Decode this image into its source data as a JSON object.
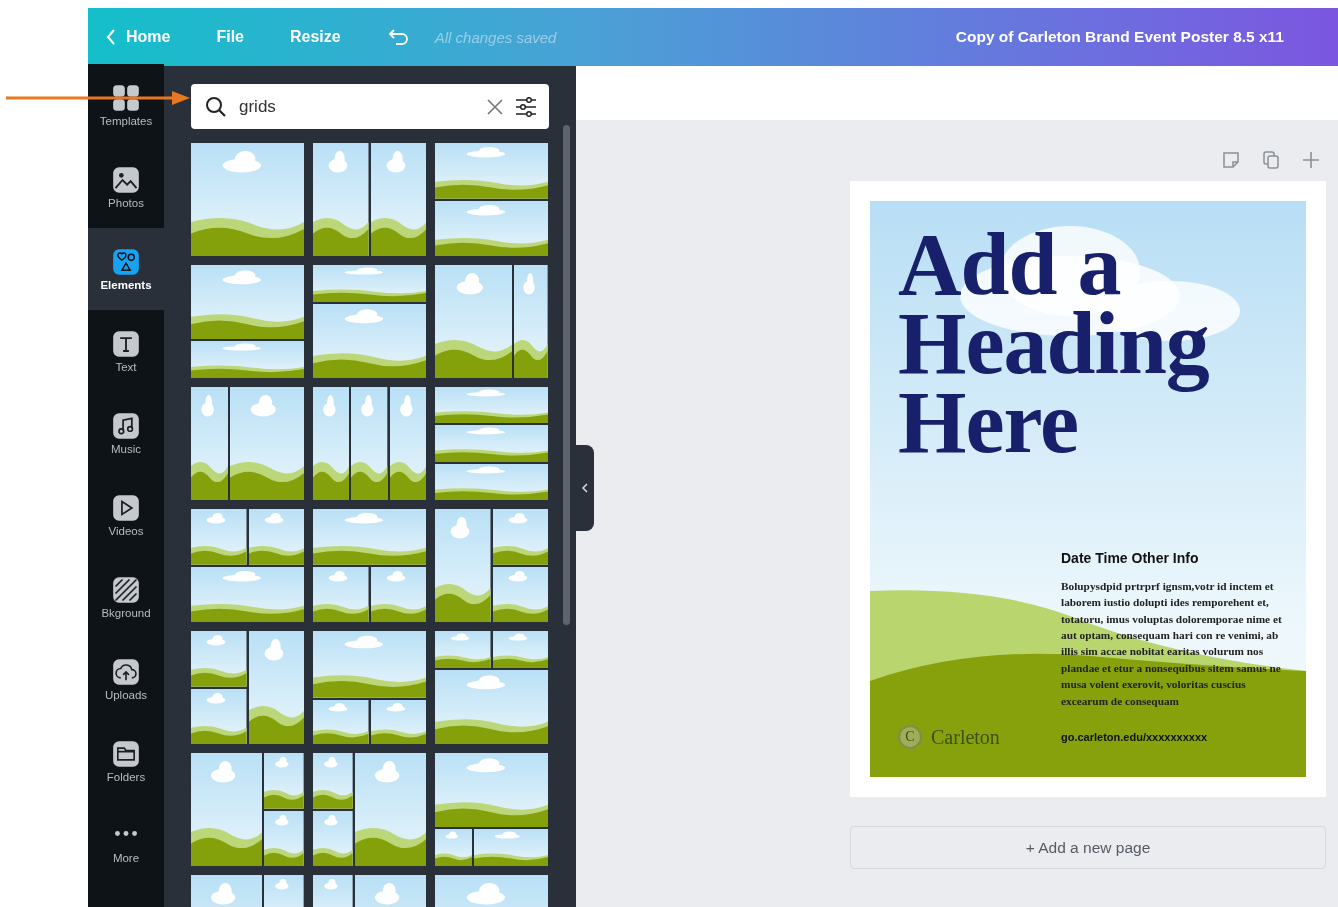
{
  "topbar": {
    "back": "Home",
    "menu": [
      "File",
      "Resize"
    ],
    "save_status": "All changes saved",
    "document_title": "Copy of Carleton Brand Event Poster 8.5 x11"
  },
  "sidebar": {
    "items": [
      {
        "label": "Templates",
        "selected": false
      },
      {
        "label": "Photos",
        "selected": false
      },
      {
        "label": "Elements",
        "selected": true
      },
      {
        "label": "Text",
        "selected": false
      },
      {
        "label": "Music",
        "selected": false
      },
      {
        "label": "Videos",
        "selected": false
      },
      {
        "label": "Bkground",
        "selected": false
      },
      {
        "label": "Uploads",
        "selected": false
      },
      {
        "label": "Folders",
        "selected": false
      },
      {
        "label": "More",
        "selected": false
      }
    ]
  },
  "search": {
    "value": "grids"
  },
  "thumbnails": [
    {
      "kind": "single"
    },
    {
      "kind": "two-columns"
    },
    {
      "kind": "two-rows"
    },
    {
      "kind": "top-large"
    },
    {
      "kind": "bottom-large"
    },
    {
      "kind": "left-wide"
    },
    {
      "kind": "right-wide"
    },
    {
      "kind": "three-columns"
    },
    {
      "kind": "three-rows"
    },
    {
      "kind": "two-over-one"
    },
    {
      "kind": "one-over-two"
    },
    {
      "kind": "tall-left-two-right"
    },
    {
      "kind": "two-left-tall-right"
    },
    {
      "kind": "large-over-two"
    },
    {
      "kind": "two-over-large"
    },
    {
      "kind": "wide-left-two-right"
    },
    {
      "kind": "two-left-wide-right"
    },
    {
      "kind": "large-over-narrow-wide"
    },
    {
      "kind": "wide-left-two-right"
    },
    {
      "kind": "two-left-wide-right"
    },
    {
      "kind": "single"
    }
  ],
  "poster": {
    "heading": "Add a Heading Here",
    "info_title": "Date Time Other Info",
    "body": "Bolupysdpid prtrprf ignsm,votr id inctem et laborem iustio dolupti ides remporehent et, totatoru, imus voluptas doloremporae nime et aut optam, consequam hari con re venimi, ab illis sim accae nobitat earitas volurum nos plandae et etur a nonsequibus sitem samus ne musa volent exerovit, voloritas cuscius excearum de consequam",
    "logo_mark": "C",
    "logo_text": "Carleton",
    "url": "go.carleton.edu/xxxxxxxxxx"
  },
  "add_page": "+ Add a new page"
}
